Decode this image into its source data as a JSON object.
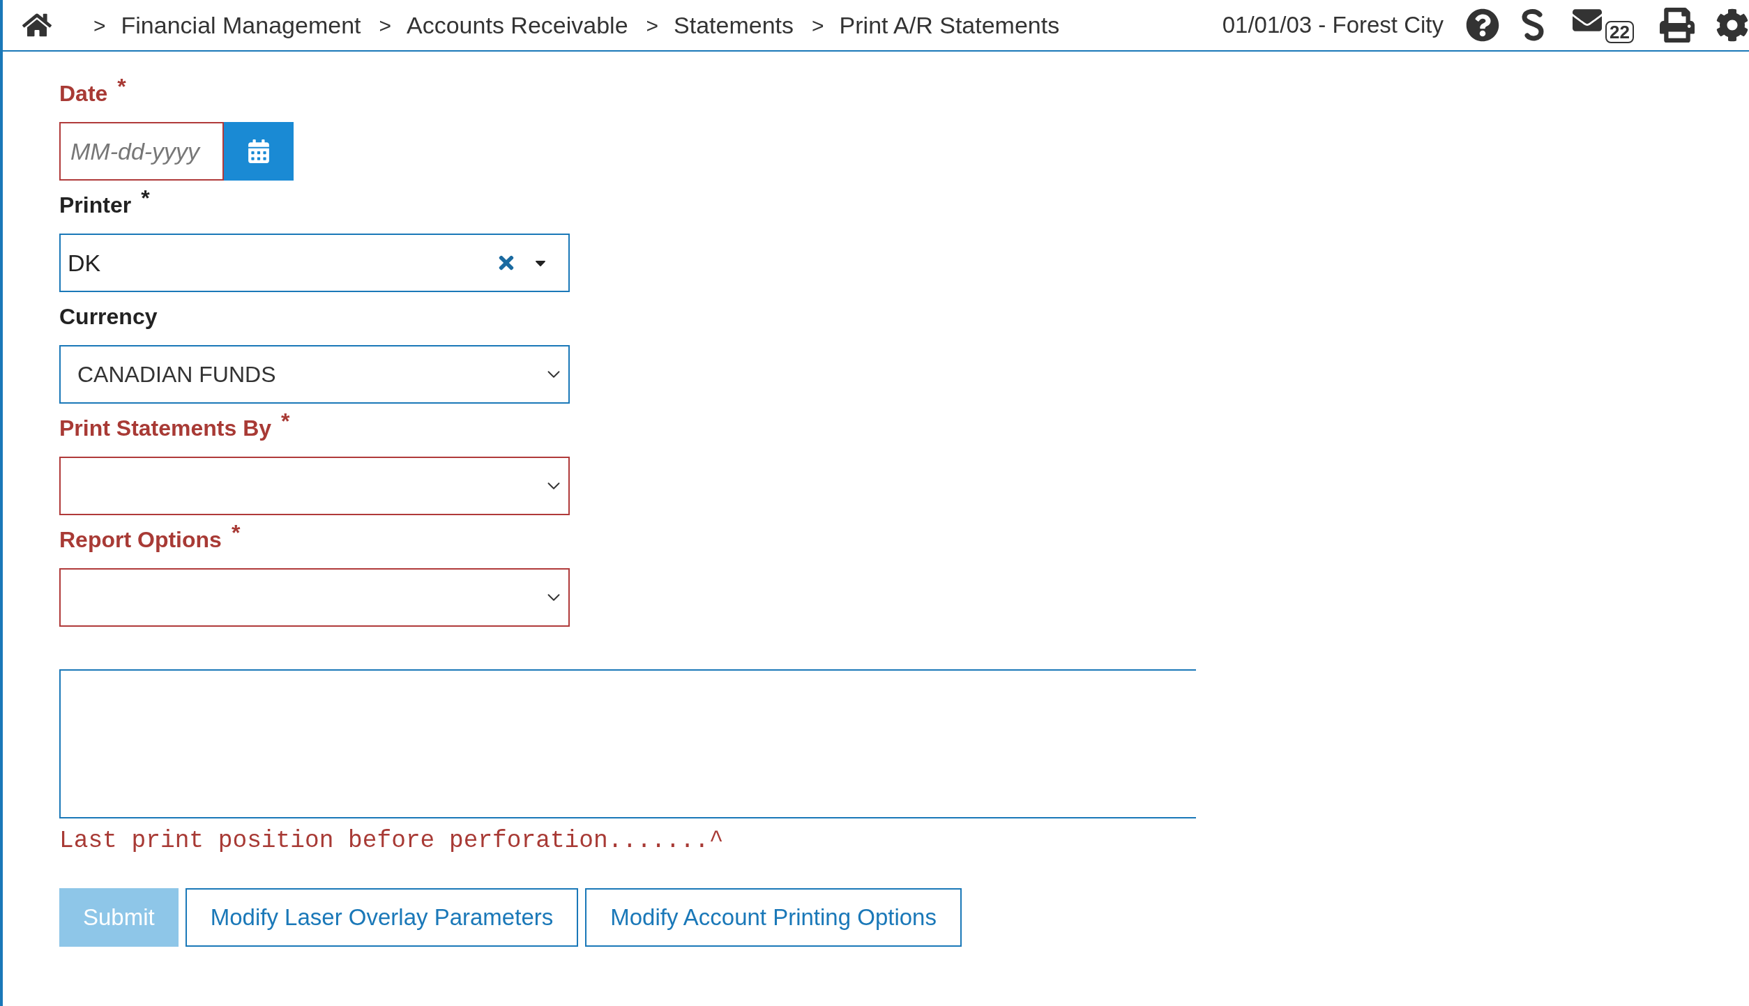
{
  "breadcrumb": [
    "Financial Management",
    "Accounts Receivable",
    "Statements",
    "Print A/R Statements"
  ],
  "breadcrumb_separator": ">",
  "session": "01/01/03 - Forest City",
  "mail_badge": "22",
  "fields": [
    {
      "kind": "date",
      "label": "Date",
      "required_mark": "*",
      "invalid": true,
      "placeholder": "MM-dd-yyyy"
    },
    {
      "kind": "combobox",
      "label": "Printer",
      "required_mark": "*",
      "invalid": false,
      "value": "DK"
    },
    {
      "kind": "select",
      "label": "Currency",
      "invalid": false,
      "value": "CANADIAN FUNDS"
    },
    {
      "kind": "select",
      "label": "Print Statements By",
      "required_mark": "*",
      "invalid": true
    },
    {
      "kind": "select",
      "label": "Report Options",
      "required_mark": "*",
      "invalid": true
    }
  ],
  "perforation_caption": "Last print position before perforation.......^",
  "buttons": [
    {
      "label": "Submit",
      "kind": "primary",
      "disabled": true
    },
    {
      "label": "Modify Laser Overlay Parameters",
      "kind": "outline",
      "disabled": false
    },
    {
      "label": "Modify Account Printing Options",
      "kind": "outline",
      "disabled": false
    }
  ]
}
